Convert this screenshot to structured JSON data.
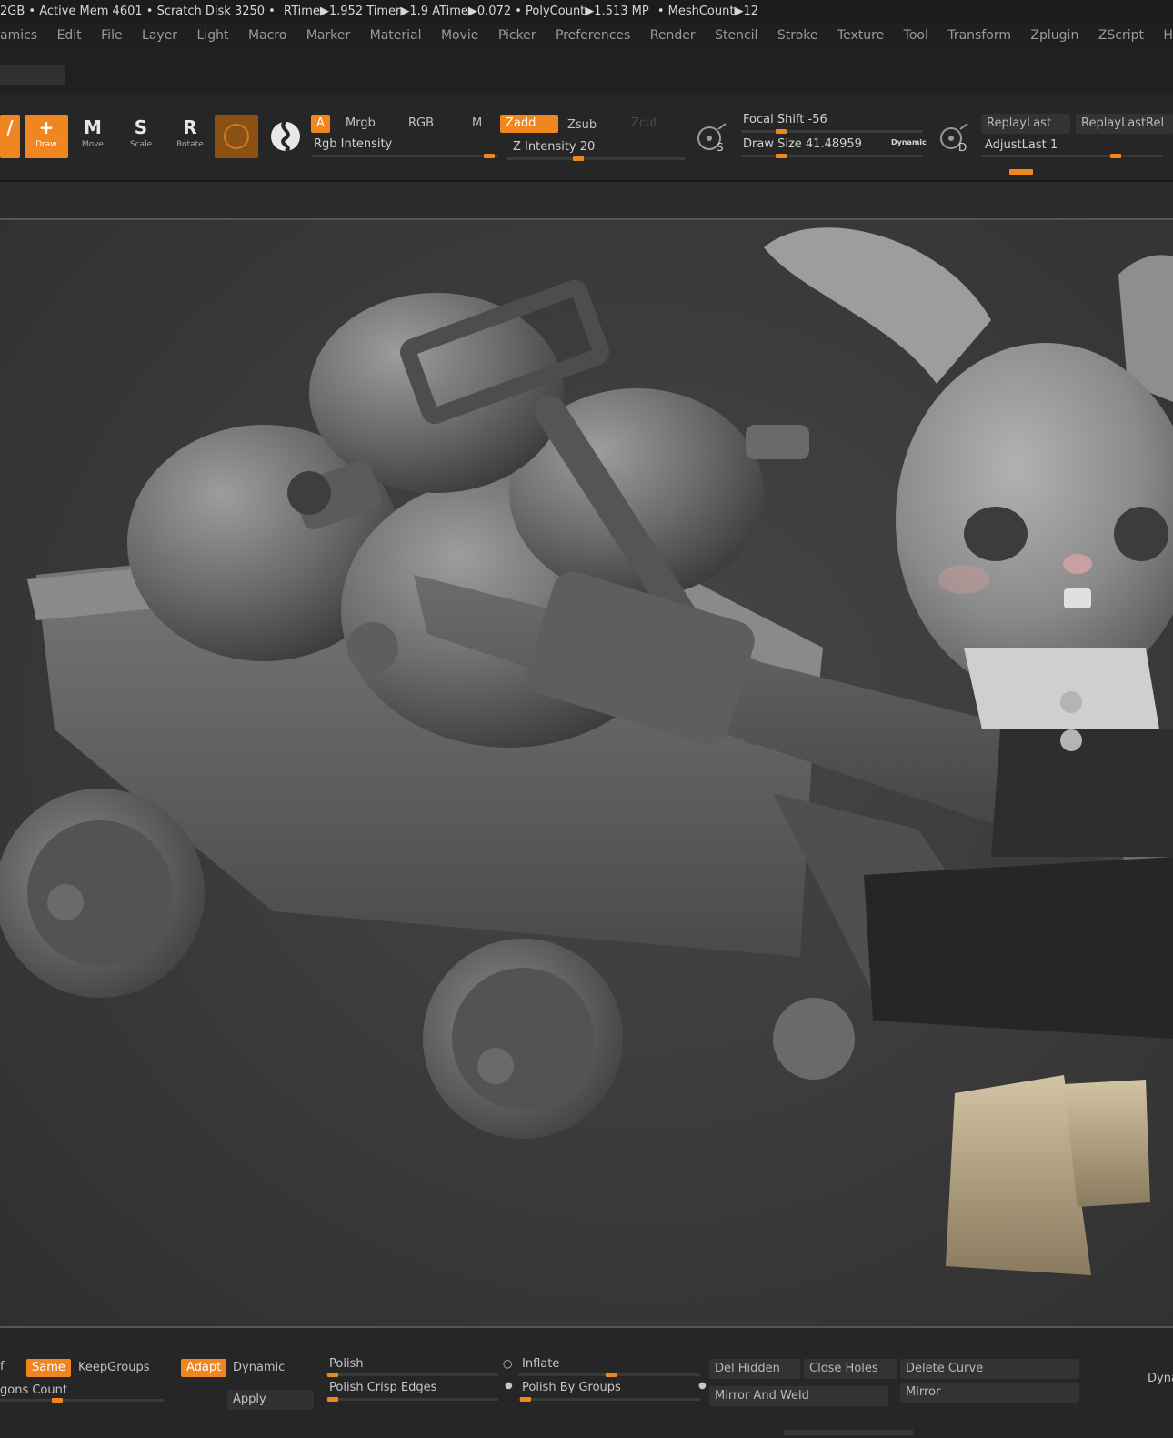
{
  "status_bar": {
    "items": [
      "2GB • Active Mem 4601 • Scratch Disk 3250 •",
      "RTime▶1.952 Timer▶1.9 ATime▶0.072 • PolyCount▶1.513 MP",
      "• MeshCount▶12"
    ]
  },
  "menu": {
    "items": [
      "amics",
      "Edit",
      "File",
      "Layer",
      "Light",
      "Macro",
      "Marker",
      "Material",
      "Movie",
      "Picker",
      "Preferences",
      "Render",
      "Stencil",
      "Stroke",
      "Texture",
      "Tool",
      "Transform",
      "Zplugin",
      "ZScript",
      "Help"
    ]
  },
  "toolbar": {
    "edit_label": "",
    "draw_label": "Draw",
    "move_label": "Move",
    "scale_label": "Scale",
    "rotate_label": "Rotate",
    "draw_letter": "+",
    "move_letter": "M",
    "scale_letter": "S",
    "rotate_letter": "R",
    "a_toggle": "A",
    "mrgb": "Mrgb",
    "rgb": "RGB",
    "m": "M",
    "rgb_intensity": "Rgb Intensity",
    "zadd": "Zadd",
    "zsub": "Zsub",
    "zcut": "Zcut",
    "z_intensity": "Z Intensity 20",
    "focal_shift": "Focal Shift -56",
    "draw_size": "Draw Size 41.48959",
    "dynamic": "Dynamic",
    "lazy_letter_s": "S",
    "lazy_letter_d": "D",
    "replay_last": "ReplayLast",
    "replay_last_rel": "ReplayLastRel",
    "adjust_last": "AdjustLast 1",
    "z_intensity_level": 0.2,
    "rgb_intensity_level": 0.95,
    "focal_shift_level": 0.22,
    "draw_size_level": 0.22
  },
  "bottom_panel": {
    "partial_left": "f",
    "same": "Same",
    "keep_groups": "KeepGroups",
    "adapt": "Adapt",
    "dynamic": "Dynamic",
    "polygons_count": "gons Count",
    "apply": "Apply",
    "polish": "Polish",
    "polish_crisp_edges": "Polish Crisp Edges",
    "inflate": "Inflate",
    "polish_by_groups": "Polish By Groups",
    "del_hidden": "Del Hidden",
    "close_holes": "Close Holes",
    "delete_curve": "Delete Curve",
    "mirror_and_weld": "Mirror And Weld",
    "mirror": "Mirror",
    "partial_right": "Dyna"
  },
  "colors": {
    "accent": "#f0861f",
    "background": "#2b2b2b",
    "viewport": "#3d3d3d",
    "text": "#c8c8c8"
  },
  "icons": [
    "draw-icon",
    "move-icon",
    "scale-icon",
    "rotate-icon",
    "material-sphere-icon",
    "brush-alpha-icon",
    "lazy-mouse-s-icon",
    "lazy-mouse-d-icon"
  ]
}
